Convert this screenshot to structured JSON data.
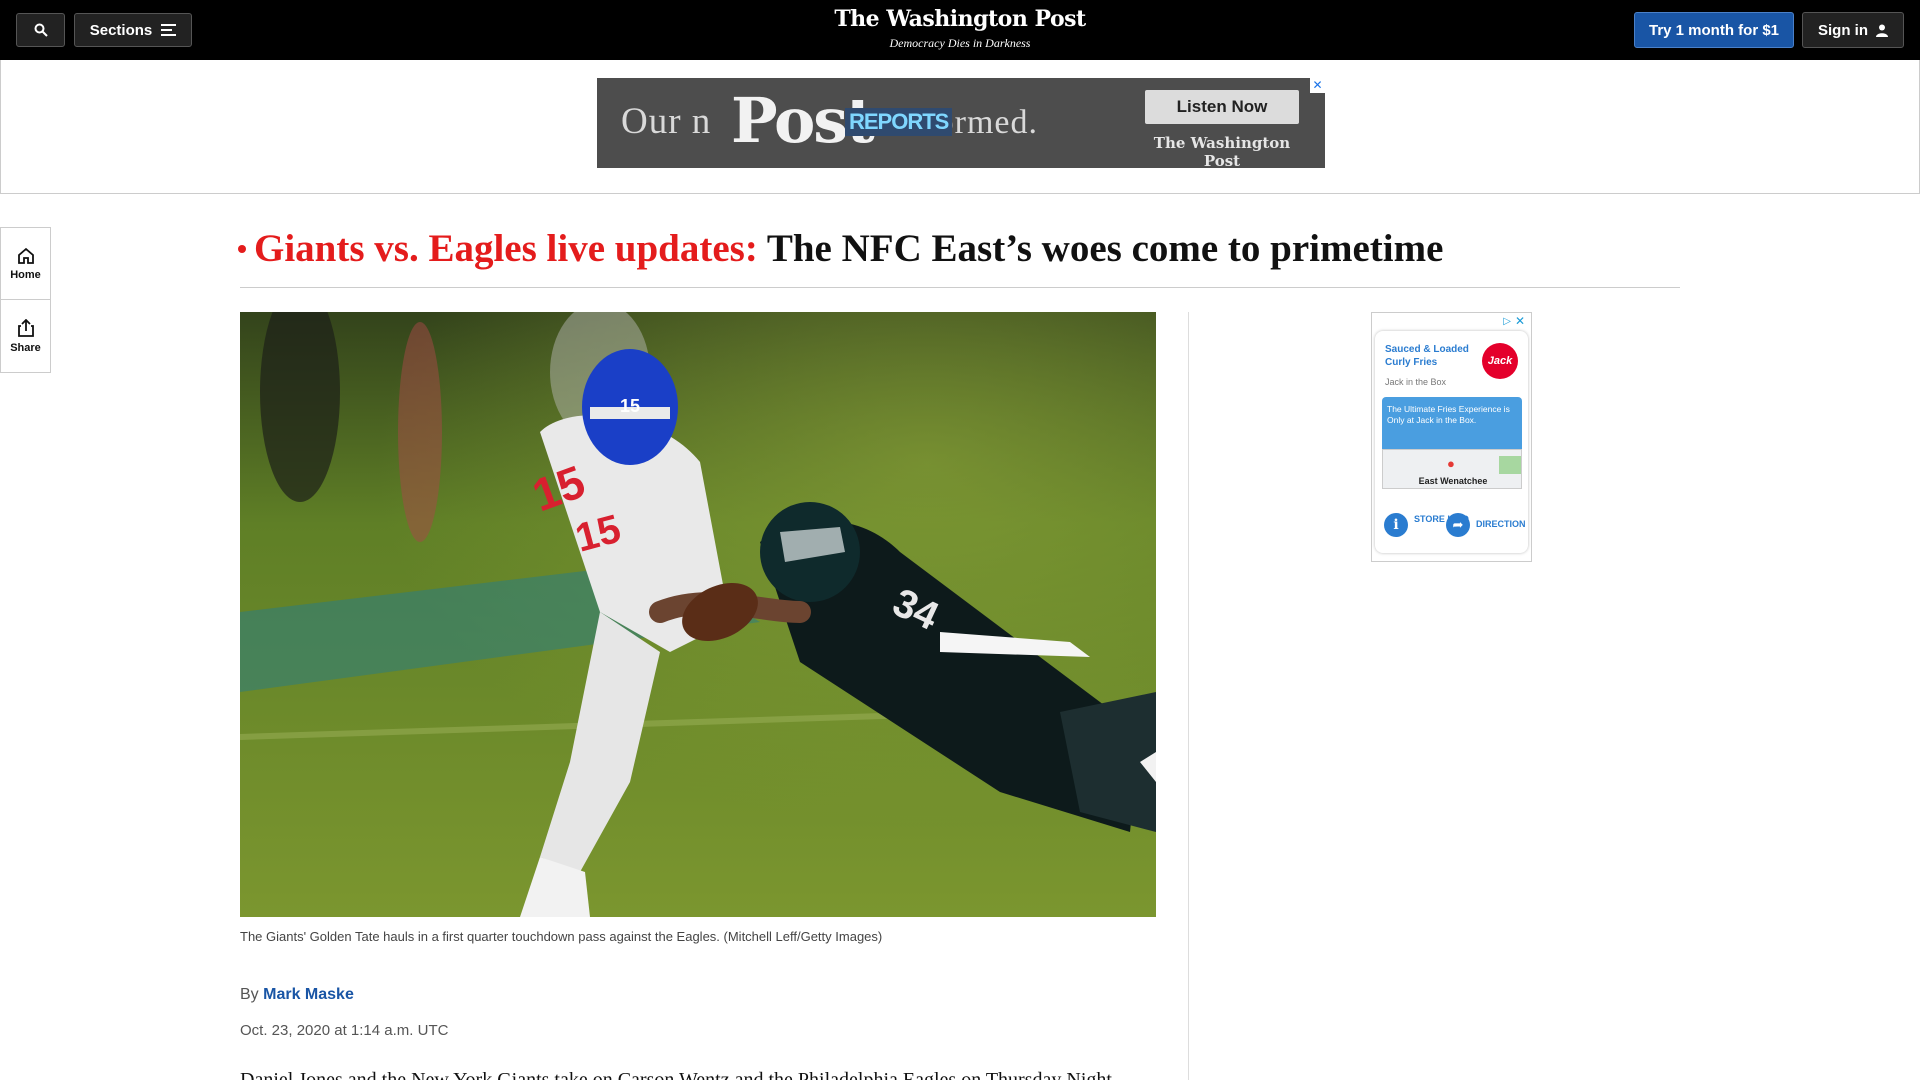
{
  "header": {
    "logo": "The Washington Post",
    "tagline": "Democracy Dies in Darkness",
    "sections_label": "Sections",
    "trial_label": "Try 1 month for $1",
    "signin_label": "Sign in"
  },
  "top_ad": {
    "text_left": "Our n",
    "text_right": "d. Informed.",
    "post_word": "Post",
    "reports_word": "REPORTS",
    "cta": "Listen Now",
    "brand": "The Washington Post"
  },
  "rail": {
    "home_label": "Home",
    "share_label": "Share"
  },
  "article": {
    "kicker": "Giants vs. Eagles live updates:",
    "title": "The NFC East’s woes come to primetime",
    "caption": "The Giants' Golden Tate hauls in a first quarter touchdown pass against the Eagles. (Mitchell Leff/Getty Images)",
    "by_prefix": "By",
    "author": "Mark Maske",
    "date": "Oct. 23, 2020 at 1:14 a.m. UTC",
    "body_start": "Daniel Jones and the New York Giants take on Carson Wentz and the Philadelphia Eagles on Thursday Night"
  },
  "side_ad": {
    "product": "Sauced & Loaded Curly Fries",
    "advertiser": "Jack in the Box",
    "logo_text": "Jack",
    "blurb": "The Ultimate Fries Experience is Only at Jack in the Box.",
    "location": "East Wenatchee",
    "store_info": "STORE INFO",
    "directions": "DIRECTION",
    "info_glyph": "i"
  },
  "colors": {
    "accent_blue": "#1955a5",
    "live_red": "#e41c1c",
    "nav_bg": "#000000"
  },
  "icons": [
    "search-icon",
    "menu-icon",
    "user-icon",
    "home-icon",
    "share-icon",
    "adchoices-icon",
    "close-icon",
    "map-pin-icon",
    "info-icon",
    "directions-icon"
  ]
}
